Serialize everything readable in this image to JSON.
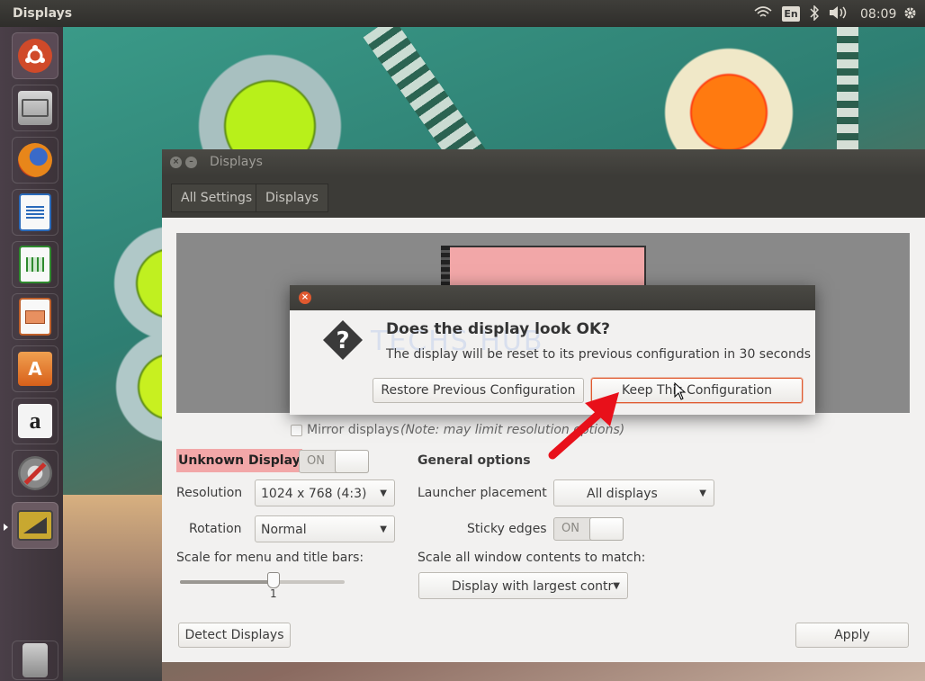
{
  "top_panel": {
    "title": "Displays",
    "keyboard_layout": "En",
    "clock": "08:09"
  },
  "launcher": {
    "items": [
      {
        "name": "ubuntu-dash-icon",
        "color": "#d04a2a"
      },
      {
        "name": "files-icon",
        "color": "#8c8c8c"
      },
      {
        "name": "firefox-icon",
        "color": "#e66a1a"
      },
      {
        "name": "writer-icon",
        "color": "#2a6aba"
      },
      {
        "name": "calc-icon",
        "color": "#2e8a2e"
      },
      {
        "name": "impress-icon",
        "color": "#c0602a"
      },
      {
        "name": "software-center-icon",
        "color": "#e8762a"
      },
      {
        "name": "amazon-icon",
        "color": "#e8e8e8"
      },
      {
        "name": "system-settings-icon",
        "color": "#7a7a7a"
      },
      {
        "name": "displays-app-icon",
        "color": "#c8a830"
      },
      {
        "name": "trash-icon",
        "color": "#9a9a9a"
      }
    ]
  },
  "window": {
    "title": "Displays",
    "breadcrumbs": [
      "All Settings",
      "Displays"
    ],
    "mirror_label": "Mirror displays",
    "mirror_note": "(Note: may limit resolution options)",
    "display_name": "Unknown Display",
    "display_switch": "ON",
    "resolution_label": "Resolution",
    "resolution_value": "1024 x 768 (4:3)",
    "rotation_label": "Rotation",
    "rotation_value": "Normal",
    "scale_label": "Scale for menu and title bars:",
    "scale_value": "1",
    "scale_fraction": 0.57,
    "general_options": "General options",
    "launcher_placement_label": "Launcher placement",
    "launcher_placement_value": "All displays",
    "sticky_edges_label": "Sticky edges",
    "sticky_edges_switch": "ON",
    "scale_all_label": "Scale all window contents to match:",
    "scale_all_value": "Display with largest contr",
    "detect_button": "Detect Displays",
    "apply_button": "Apply"
  },
  "dialog": {
    "heading": "Does the display look OK?",
    "message": "The display will be reset to its previous configuration in 30 seconds",
    "restore_button": "Restore Previous Configuration",
    "keep_button": "Keep This Configuration",
    "watermark": "TECHS HUB"
  }
}
